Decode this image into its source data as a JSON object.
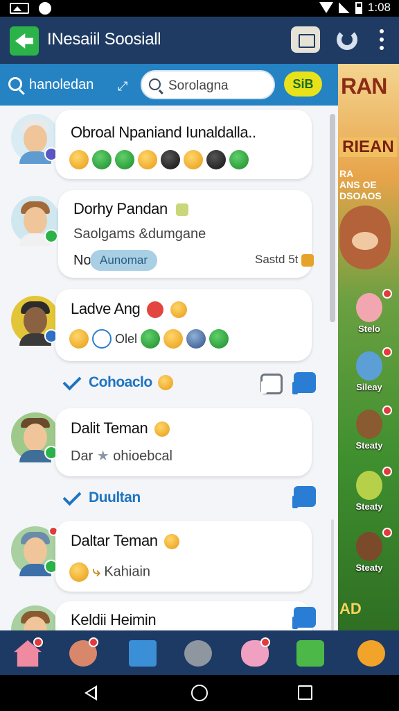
{
  "status_bar": {
    "time": "1:08"
  },
  "app_bar": {
    "title": "INesaiil Soosiall"
  },
  "search_row": {
    "label": "hanoledan",
    "search_placeholder": "Sorolagna",
    "pill_label": "SiB"
  },
  "feed": {
    "posts": [
      {
        "name": "Obroal Npaniand Iunaldalla..",
        "line": "",
        "tag": ""
      },
      {
        "name": "Dorhy Pandan",
        "line": "Saolgams &dumgane",
        "prefix": "No",
        "tag": "Aunomar",
        "meta": "Sastd 5t"
      },
      {
        "name": "Ladve Ang",
        "line": "Olel"
      },
      {
        "name": "Dalit Teman",
        "line_a": "Dar",
        "line_b": "ohioebcal"
      },
      {
        "name": "Daltar Teman",
        "line": "Kahiain"
      },
      {
        "name": "Keldii Heimin"
      }
    ],
    "check_rows": [
      {
        "label": "Cohoaclo"
      },
      {
        "label": "Duultan"
      }
    ]
  },
  "game_panel": {
    "title": "RAN",
    "subtitle": "RIEAN",
    "sign_lines": [
      "RA",
      "ANS OE",
      "DSOAOS"
    ],
    "items": [
      {
        "label": "Stelo"
      },
      {
        "label": "Sileay"
      },
      {
        "label": "Steaty"
      },
      {
        "label": "Steaty"
      },
      {
        "label": "Steaty"
      }
    ],
    "bottom": "AD"
  },
  "tab_bar": {
    "tabs": [
      "home-icon",
      "avatar-icon",
      "shop-icon",
      "tool-icon",
      "pig-icon",
      "robot-icon",
      "face-icon"
    ]
  },
  "colors": {
    "app_bar": "#1f3b63",
    "search_row": "#2583c4",
    "accent_blue": "#1f74c0",
    "pill_yellow": "#e8e21a"
  }
}
